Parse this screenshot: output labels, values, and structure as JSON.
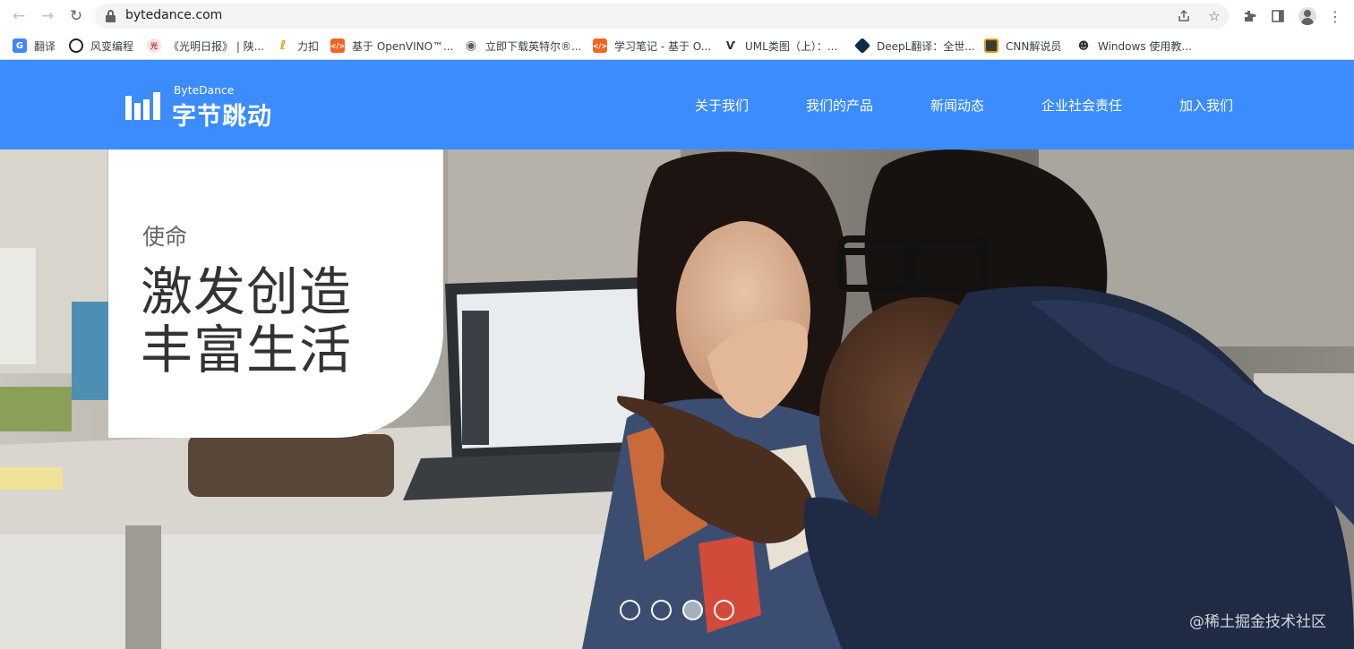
{
  "browser": {
    "url": "bytedance.com",
    "bookmarks": [
      {
        "label": "翻译",
        "icon": "translate-icon"
      },
      {
        "label": "风变编程",
        "icon": "panda-icon"
      },
      {
        "label": "《光明日报》 | 陕...",
        "icon": "guangming-icon"
      },
      {
        "label": "力扣",
        "icon": "leetcode-icon"
      },
      {
        "label": "基于 OpenVINO™...",
        "icon": "code-icon"
      },
      {
        "label": "立即下载英特尔®...",
        "icon": "globe-icon"
      },
      {
        "label": "学习笔记 - 基于 O...",
        "icon": "code-icon"
      },
      {
        "label": "UML类图（上）：...",
        "icon": "uml-icon"
      },
      {
        "label": "DeepL翻译：全世...",
        "icon": "deepl-icon"
      },
      {
        "label": "CNN解说员",
        "icon": "cnn-icon"
      },
      {
        "label": "Windows 使用教...",
        "icon": "windows-icon"
      }
    ]
  },
  "site": {
    "logo_en": "ByteDance",
    "logo_cn": "字节跳动",
    "nav": [
      "关于我们",
      "我们的产品",
      "新闻动态",
      "企业社会责任",
      "加入我们"
    ],
    "brand_color": "#3c8cfe"
  },
  "hero": {
    "label": "使命",
    "line1": "激发创造",
    "line2": "丰富生活",
    "carousel": {
      "count": 4,
      "active_index": 2
    },
    "watermark": "@稀土掘金技术社区"
  }
}
